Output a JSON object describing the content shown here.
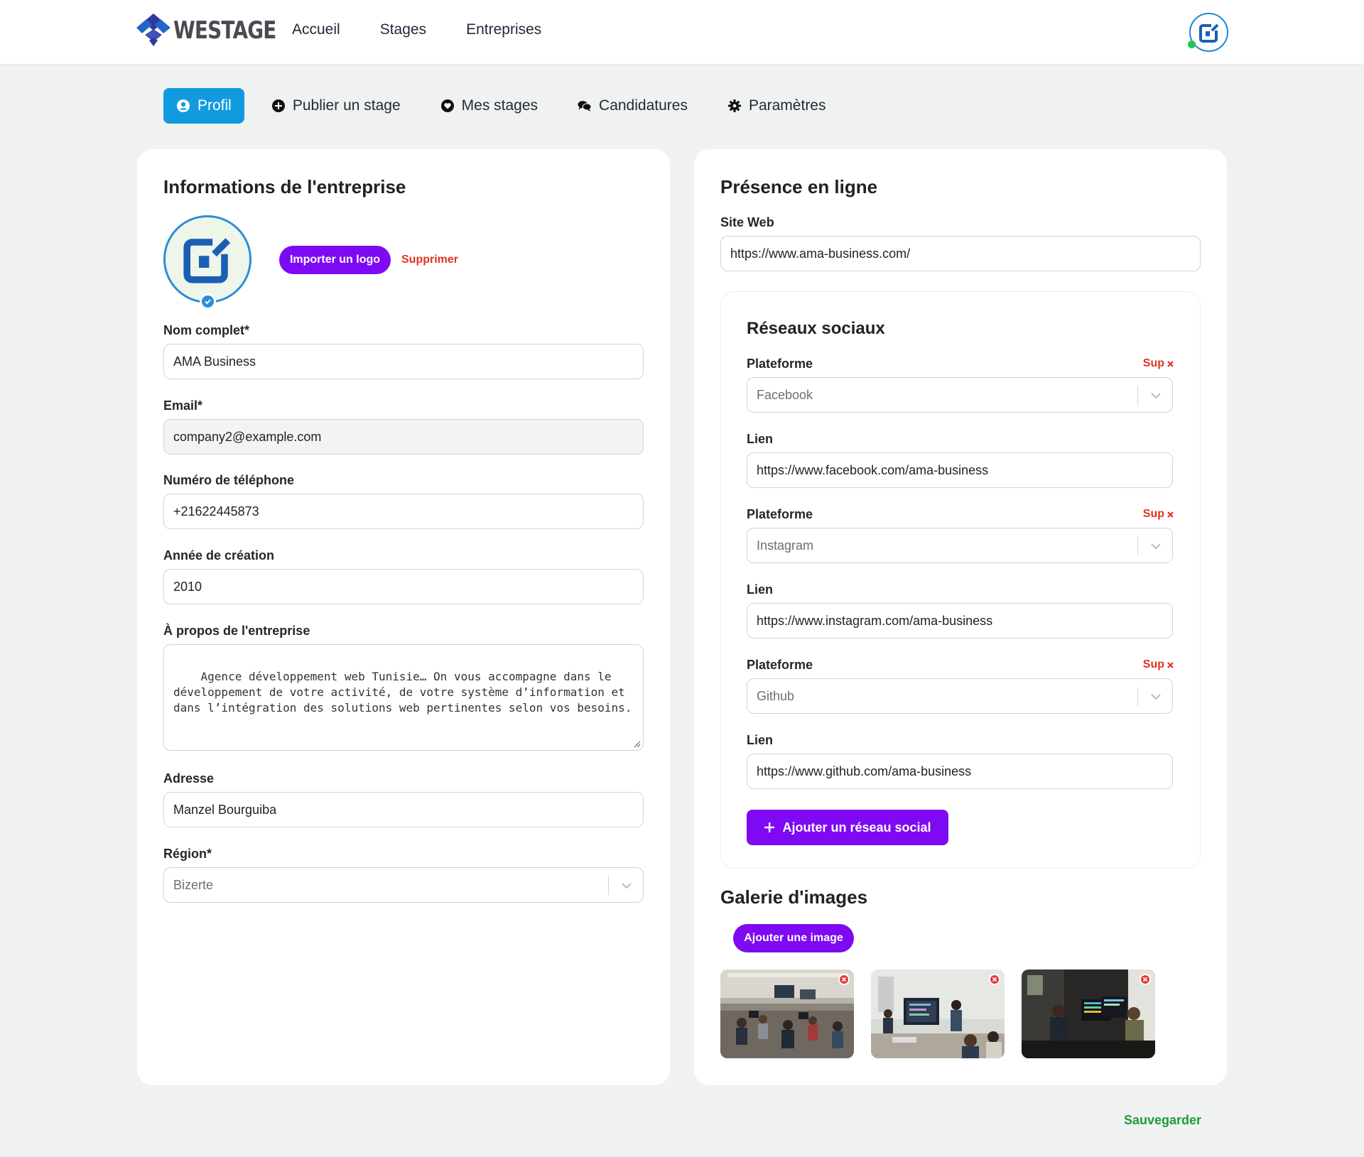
{
  "navbar": {
    "brand": "WESTAGE",
    "links": [
      "Accueil",
      "Stages",
      "Entreprises"
    ]
  },
  "tabs": [
    {
      "label": "Profil",
      "icon": "user-circle-icon",
      "active": true
    },
    {
      "label": "Publier un stage",
      "icon": "plus-circle-icon"
    },
    {
      "label": "Mes stages",
      "icon": "heart-circle-icon"
    },
    {
      "label": "Candidatures",
      "icon": "comments-icon"
    },
    {
      "label": "Paramètres",
      "icon": "gear-icon"
    }
  ],
  "company": {
    "title": "Informations de l'entreprise",
    "import_logo": "Importer un logo",
    "delete_logo": "Supprimer",
    "fields": {
      "name": {
        "label": "Nom complet*",
        "value": "AMA Business"
      },
      "email": {
        "label": "Email*",
        "value": "company2@example.com"
      },
      "phone": {
        "label": "Numéro de téléphone",
        "value": "+21622445873"
      },
      "year": {
        "label": "Année de création",
        "value": "2010"
      },
      "about": {
        "label": "À propos de l'entreprise",
        "value": "Agence développement web Tunisie… On vous accompagne dans le développement de votre activité, de votre système d’information et dans l’intégration des solutions web pertinentes selon vos besoins."
      },
      "address": {
        "label": "Adresse",
        "value": "Manzel Bourguiba"
      },
      "region": {
        "label": "Région*",
        "value": "Bizerte"
      }
    }
  },
  "online": {
    "title": "Présence en ligne",
    "website": {
      "label": "Site Web",
      "value": "https://www.ama-business.com/"
    },
    "social": {
      "title": "Réseaux sociaux",
      "platform_label": "Plateforme",
      "link_label": "Lien",
      "remove_label": "Sup",
      "items": [
        {
          "platform": "Facebook",
          "link": "https://www.facebook.com/ama-business"
        },
        {
          "platform": "Instagram",
          "link": "https://www.instagram.com/ama-business"
        },
        {
          "platform": "Github",
          "link": "https://www.github.com/ama-business"
        }
      ],
      "add_button": "Ajouter un réseau social"
    },
    "gallery": {
      "title": "Galerie d'images",
      "add_button": "Ajouter une image"
    }
  },
  "save_label": "Sauvegarder",
  "colors": {
    "accent_blue": "#129adf",
    "purple": "#7d0af2",
    "danger": "#e0321f",
    "success": "#1f9b3c"
  }
}
